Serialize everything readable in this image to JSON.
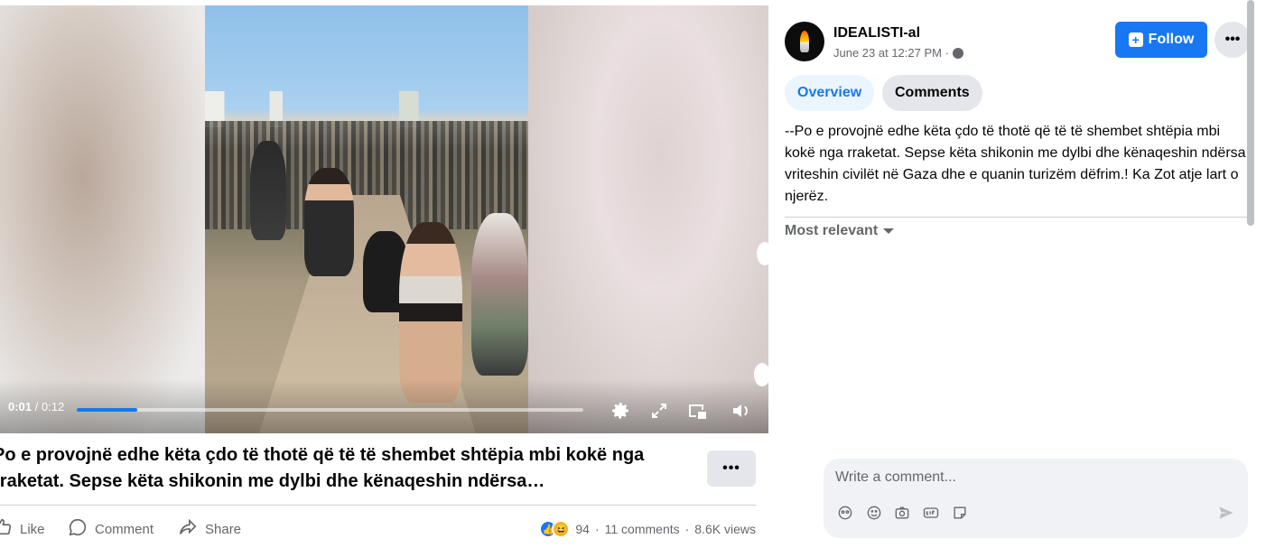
{
  "video": {
    "current_time": "0:01",
    "total_time": " / 0:12",
    "progress_fraction": 0.12
  },
  "caption": {
    "text": "Po e provojnë edhe këta çdo të thotë që të të shembet shtëpia mbi kokë nga rraketat. Sepse këta shikonin me dylbi dhe kënaqeshin ndërsa…"
  },
  "post_actions": {
    "more_label": "•••",
    "like_label": "Like",
    "comment_label": "Comment",
    "share_label": "Share"
  },
  "stats": {
    "reactions_count": "94",
    "comments": "11 comments",
    "separator": "·",
    "views": "8.6K views"
  },
  "page": {
    "name": "IDEALISTI-al",
    "date": "June 23 at 12:27 PM ·",
    "follow_label": "Follow",
    "more_label": "•••"
  },
  "tabs": [
    {
      "label": "Overview",
      "active": true
    },
    {
      "label": "Comments",
      "active": false
    }
  ],
  "post": {
    "text": "--Po e provojnë edhe këta çdo të thotë që të të shembet shtëpia mbi kokë nga rraketat. Sepse këta shikonin me dylbi dhe kënaqeshin ndërsa vriteshin civilët në Gaza dhe e quanin turizëm dëfrim.! Ka Zot atje lart o njerëz."
  },
  "sort": {
    "label": "Most relevant"
  },
  "comment_box": {
    "placeholder": "Write a comment..."
  },
  "colors": {
    "accent": "#1877f2",
    "text_primary": "#050505",
    "text_secondary": "#65676b",
    "button_gray": "#e4e6eb"
  },
  "icons": [
    "settings-icon",
    "fullscreen-icon",
    "pip-icon",
    "volume-icon",
    "like-icon",
    "comment-icon",
    "share-icon",
    "avatar-sticker-icon",
    "emoji-icon",
    "camera-icon",
    "gif-icon",
    "sticker-icon",
    "send-icon"
  ]
}
